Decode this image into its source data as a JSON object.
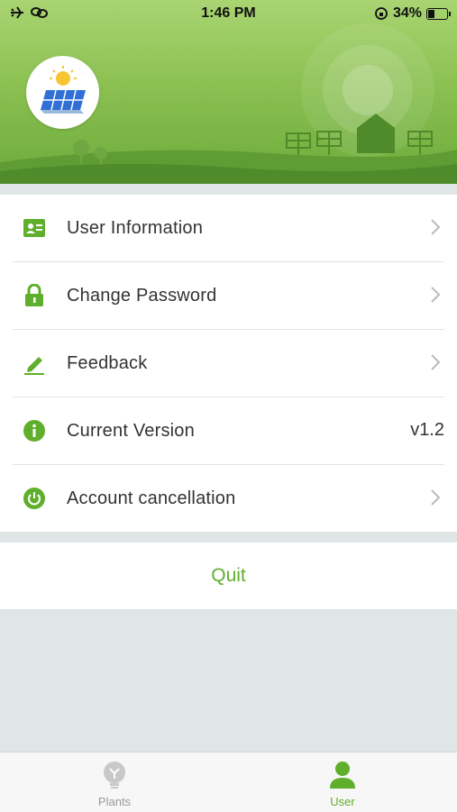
{
  "status_bar": {
    "time": "1:46 PM",
    "battery_pct": "34%",
    "battery_level": 0.34
  },
  "menu": {
    "items": [
      {
        "label": "User Information",
        "icon": "id-card-icon",
        "chevron": true
      },
      {
        "label": "Change Password",
        "icon": "lock-icon",
        "chevron": true
      },
      {
        "label": "Feedback",
        "icon": "pencil-icon",
        "chevron": true
      },
      {
        "label": "Current Version",
        "icon": "info-icon",
        "value": "v1.2",
        "chevron": false
      },
      {
        "label": "Account cancellation",
        "icon": "power-icon",
        "chevron": true
      }
    ]
  },
  "quit_label": "Quit",
  "tabbar": {
    "tabs": [
      {
        "label": "Plants",
        "icon": "bulb-icon",
        "active": false
      },
      {
        "label": "User",
        "icon": "user-icon",
        "active": true
      }
    ]
  },
  "colors": {
    "accent": "#5fae2c",
    "header_top": "#a9d472",
    "header_bottom": "#6cab3b",
    "background": "#e0e6e6"
  }
}
